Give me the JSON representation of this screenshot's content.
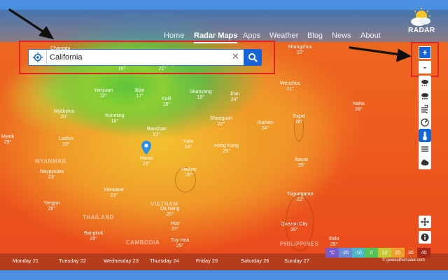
{
  "nav": {
    "items": [
      {
        "label": "Home",
        "active": false
      },
      {
        "label": "Radar Maps",
        "active": true
      },
      {
        "label": "Apps",
        "active": false
      },
      {
        "label": "Weather",
        "active": false
      },
      {
        "label": "Blog",
        "active": false
      },
      {
        "label": "News",
        "active": false
      },
      {
        "label": "About",
        "active": false
      }
    ],
    "logo_text": "RADAR"
  },
  "search": {
    "value": "California",
    "clear_icon": "close-icon",
    "button_icon": "search-icon",
    "location_icon": "crosshair-icon"
  },
  "zoom": {
    "in_label": "+",
    "out_label": "-"
  },
  "layers": [
    {
      "icon": "rain-icon",
      "selected": false
    },
    {
      "icon": "snow-icon",
      "selected": false
    },
    {
      "icon": "wind-icon",
      "selected": false
    },
    {
      "icon": "pressure-icon",
      "selected": false
    },
    {
      "icon": "temperature-icon",
      "selected": true
    },
    {
      "icon": "fog-icon",
      "selected": false
    },
    {
      "icon": "cloud-icon",
      "selected": false
    }
  ],
  "map": {
    "cities": [
      {
        "name": "Changdu",
        "temp": ""
      },
      {
        "name": "Chengdu",
        "temp": "16°"
      },
      {
        "name": "Chongqing",
        "temp": "21°"
      },
      {
        "name": "Yanyuan",
        "temp": "12°"
      },
      {
        "name": "Bijie",
        "temp": "17°"
      },
      {
        "name": "Kaili",
        "temp": "18°"
      },
      {
        "name": "Shaoyang",
        "temp": "19°"
      },
      {
        "name": "Ji'an",
        "temp": "24°"
      },
      {
        "name": "Wenzhou",
        "temp": "21°"
      },
      {
        "name": "Shangzhou",
        "temp": "22°"
      },
      {
        "name": "Myitkyina",
        "temp": "20°"
      },
      {
        "name": "Kunming",
        "temp": "18°"
      },
      {
        "name": "Shaoguan",
        "temp": "22°"
      },
      {
        "name": "Xiamen",
        "temp": "24°"
      },
      {
        "name": "Taipei",
        "temp": "26°"
      },
      {
        "name": "Naha",
        "temp": "26°"
      },
      {
        "name": "Lashio",
        "temp": "19°"
      },
      {
        "name": "Baoshan",
        "temp": "21°"
      },
      {
        "name": "Yulin",
        "temp": "24°"
      },
      {
        "name": "Hong Kong",
        "temp": "25°"
      },
      {
        "name": "Hanoi",
        "temp": "23°"
      },
      {
        "name": "Haikou",
        "temp": "26°"
      },
      {
        "name": "Ibayat",
        "temp": "26°"
      },
      {
        "name": "Naypyidaw",
        "temp": "23°"
      },
      {
        "name": "Vientiane",
        "temp": "23°"
      },
      {
        "name": "Yangon",
        "temp": "26°"
      },
      {
        "name": "Da Nang",
        "temp": "25°"
      },
      {
        "name": "Tuguegarao",
        "temp": "22°"
      },
      {
        "name": "Bangkok",
        "temp": "25°"
      },
      {
        "name": "Tuy Hoa",
        "temp": "25°"
      },
      {
        "name": "Quezon City",
        "temp": "26°"
      },
      {
        "name": "Iloilo",
        "temp": "26°"
      },
      {
        "name": "Hue",
        "temp": "27°"
      },
      {
        "name": "Myeik",
        "temp": "29°"
      }
    ],
    "regions": [
      "MYANMAR",
      "THAILAND",
      "VIETNAM",
      "CAMBODIA",
      "PHILIPPINES"
    ]
  },
  "timeline": {
    "days": [
      "Monday 21",
      "Tuesday 22",
      "Wednesday 23",
      "Thursday 24",
      "Friday 25",
      "Saturday 26",
      "Sunday 27"
    ]
  },
  "legend": {
    "unit": "°C",
    "values": [
      "-20",
      "-10",
      "0",
      "10",
      "20",
      "30",
      "40"
    ],
    "colors": [
      "#7b5ac8",
      "#6a8ad8",
      "#4bb7c9",
      "#55c25a",
      "#c7c934",
      "#f0a02c",
      "#e6521c",
      "#a8281a"
    ]
  },
  "credit": "© goweatherradar.com",
  "accent": "#1565d8",
  "highlight": "#e02424"
}
